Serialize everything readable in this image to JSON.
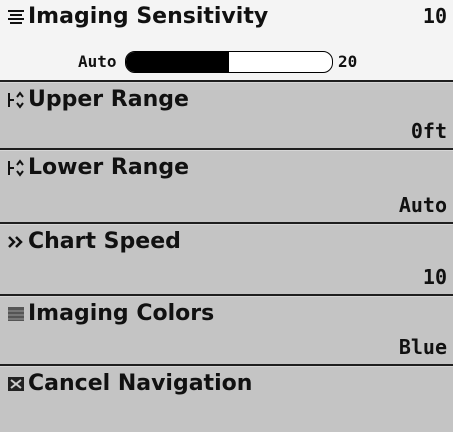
{
  "menu": {
    "items": [
      {
        "label": "Imaging Sensitivity",
        "value": "10",
        "icon": "sensitivity-icon"
      },
      {
        "label": "Upper Range",
        "value": "0ft",
        "icon": "upper-range-icon"
      },
      {
        "label": "Lower Range",
        "value": "Auto",
        "icon": "lower-range-icon"
      },
      {
        "label": "Chart Speed",
        "value": "10",
        "icon": "chart-speed-icon"
      },
      {
        "label": "Imaging Colors",
        "value": "Blue",
        "icon": "imaging-colors-icon"
      },
      {
        "label": "Cancel Navigation",
        "value": "",
        "icon": "cancel-navigation-icon"
      }
    ],
    "sensitivity_bar": {
      "min_label": "Auto",
      "max_label": "20",
      "level_fraction": 0.5
    }
  }
}
